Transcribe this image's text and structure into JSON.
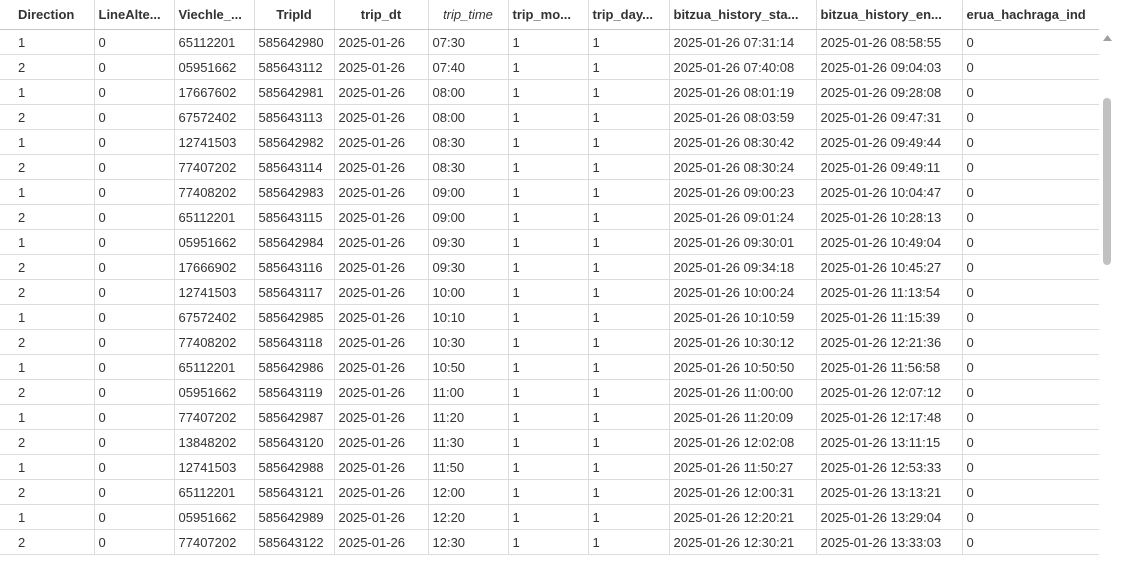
{
  "columns": [
    {
      "label": "Direction"
    },
    {
      "label": "LineAlte..."
    },
    {
      "label": "Viechle_..."
    },
    {
      "label": "TripId"
    },
    {
      "label": "trip_dt"
    },
    {
      "label": "trip_time"
    },
    {
      "label": "trip_mo..."
    },
    {
      "label": "trip_day..."
    },
    {
      "label": "bitzua_history_sta..."
    },
    {
      "label": "bitzua_history_en..."
    },
    {
      "label": "erua_hachraga_ind"
    }
  ],
  "rows": [
    [
      "1",
      "0",
      "65112201",
      "585642980",
      "2025-01-26",
      "07:30",
      "1",
      "1",
      "2025-01-26 07:31:14",
      "2025-01-26 08:58:55",
      "0"
    ],
    [
      "2",
      "0",
      "05951662",
      "585643112",
      "2025-01-26",
      "07:40",
      "1",
      "1",
      "2025-01-26 07:40:08",
      "2025-01-26 09:04:03",
      "0"
    ],
    [
      "1",
      "0",
      "17667602",
      "585642981",
      "2025-01-26",
      "08:00",
      "1",
      "1",
      "2025-01-26 08:01:19",
      "2025-01-26 09:28:08",
      "0"
    ],
    [
      "2",
      "0",
      "67572402",
      "585643113",
      "2025-01-26",
      "08:00",
      "1",
      "1",
      "2025-01-26 08:03:59",
      "2025-01-26 09:47:31",
      "0"
    ],
    [
      "1",
      "0",
      "12741503",
      "585642982",
      "2025-01-26",
      "08:30",
      "1",
      "1",
      "2025-01-26 08:30:42",
      "2025-01-26 09:49:44",
      "0"
    ],
    [
      "2",
      "0",
      "77407202",
      "585643114",
      "2025-01-26",
      "08:30",
      "1",
      "1",
      "2025-01-26 08:30:24",
      "2025-01-26 09:49:11",
      "0"
    ],
    [
      "1",
      "0",
      "77408202",
      "585642983",
      "2025-01-26",
      "09:00",
      "1",
      "1",
      "2025-01-26 09:00:23",
      "2025-01-26 10:04:47",
      "0"
    ],
    [
      "2",
      "0",
      "65112201",
      "585643115",
      "2025-01-26",
      "09:00",
      "1",
      "1",
      "2025-01-26 09:01:24",
      "2025-01-26 10:28:13",
      "0"
    ],
    [
      "1",
      "0",
      "05951662",
      "585642984",
      "2025-01-26",
      "09:30",
      "1",
      "1",
      "2025-01-26 09:30:01",
      "2025-01-26 10:49:04",
      "0"
    ],
    [
      "2",
      "0",
      "17666902",
      "585643116",
      "2025-01-26",
      "09:30",
      "1",
      "1",
      "2025-01-26 09:34:18",
      "2025-01-26 10:45:27",
      "0"
    ],
    [
      "2",
      "0",
      "12741503",
      "585643117",
      "2025-01-26",
      "10:00",
      "1",
      "1",
      "2025-01-26 10:00:24",
      "2025-01-26 11:13:54",
      "0"
    ],
    [
      "1",
      "0",
      "67572402",
      "585642985",
      "2025-01-26",
      "10:10",
      "1",
      "1",
      "2025-01-26 10:10:59",
      "2025-01-26 11:15:39",
      "0"
    ],
    [
      "2",
      "0",
      "77408202",
      "585643118",
      "2025-01-26",
      "10:30",
      "1",
      "1",
      "2025-01-26 10:30:12",
      "2025-01-26 12:21:36",
      "0"
    ],
    [
      "1",
      "0",
      "65112201",
      "585642986",
      "2025-01-26",
      "10:50",
      "1",
      "1",
      "2025-01-26 10:50:50",
      "2025-01-26 11:56:58",
      "0"
    ],
    [
      "2",
      "0",
      "05951662",
      "585643119",
      "2025-01-26",
      "11:00",
      "1",
      "1",
      "2025-01-26 11:00:00",
      "2025-01-26 12:07:12",
      "0"
    ],
    [
      "1",
      "0",
      "77407202",
      "585642987",
      "2025-01-26",
      "11:20",
      "1",
      "1",
      "2025-01-26 11:20:09",
      "2025-01-26 12:17:48",
      "0"
    ],
    [
      "2",
      "0",
      "13848202",
      "585643120",
      "2025-01-26",
      "11:30",
      "1",
      "1",
      "2025-01-26 12:02:08",
      "2025-01-26 13:11:15",
      "0"
    ],
    [
      "1",
      "0",
      "12741503",
      "585642988",
      "2025-01-26",
      "11:50",
      "1",
      "1",
      "2025-01-26 11:50:27",
      "2025-01-26 12:53:33",
      "0"
    ],
    [
      "2",
      "0",
      "65112201",
      "585643121",
      "2025-01-26",
      "12:00",
      "1",
      "1",
      "2025-01-26 12:00:31",
      "2025-01-26 13:13:21",
      "0"
    ],
    [
      "1",
      "0",
      "05951662",
      "585642989",
      "2025-01-26",
      "12:20",
      "1",
      "1",
      "2025-01-26 12:20:21",
      "2025-01-26 13:29:04",
      "0"
    ],
    [
      "2",
      "0",
      "77407202",
      "585643122",
      "2025-01-26",
      "12:30",
      "1",
      "1",
      "2025-01-26 12:30:21",
      "2025-01-26 13:33:03",
      "0"
    ]
  ],
  "icons": {
    "scroll_up": "scroll-up-arrow-icon"
  },
  "colors": {
    "grid_line": "#dcdcdc",
    "text": "#333333",
    "scroll_thumb": "#c1c1c1"
  }
}
